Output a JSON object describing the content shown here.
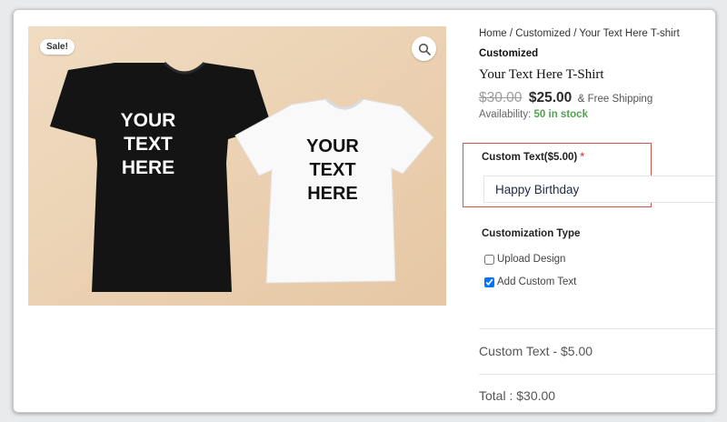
{
  "breadcrumb": {
    "home": "Home",
    "sep1": " / ",
    "category": "Customized",
    "sep2": " / ",
    "current": "Your Text Here T-shirt"
  },
  "product": {
    "category": "Customized",
    "title": "Your Text Here T-Shirt",
    "old_price": "$30.00",
    "new_price": "$25.00",
    "shipping": "& Free Shipping",
    "availability_label": "Availability:",
    "stock": "50 in stock",
    "sale_badge": "Sale!",
    "zoom_icon": "search-icon",
    "shirt_text": [
      "YOUR",
      "TEXT",
      "HERE"
    ]
  },
  "custom_text": {
    "label": "Custom Text($5.00)",
    "required_mark": "*",
    "value": "Happy Birthday"
  },
  "customization_type": {
    "label": "Customization Type",
    "options": [
      {
        "label": "Upload Design",
        "checked": false
      },
      {
        "label": "Add Custom Text",
        "checked": true
      }
    ]
  },
  "summary": {
    "line_item": "Custom Text - $5.00",
    "total": "Total : $30.00"
  },
  "colors": {
    "highlight": "#d9534f",
    "stock": "#52a152",
    "backdrop": "#ecd3b3"
  }
}
